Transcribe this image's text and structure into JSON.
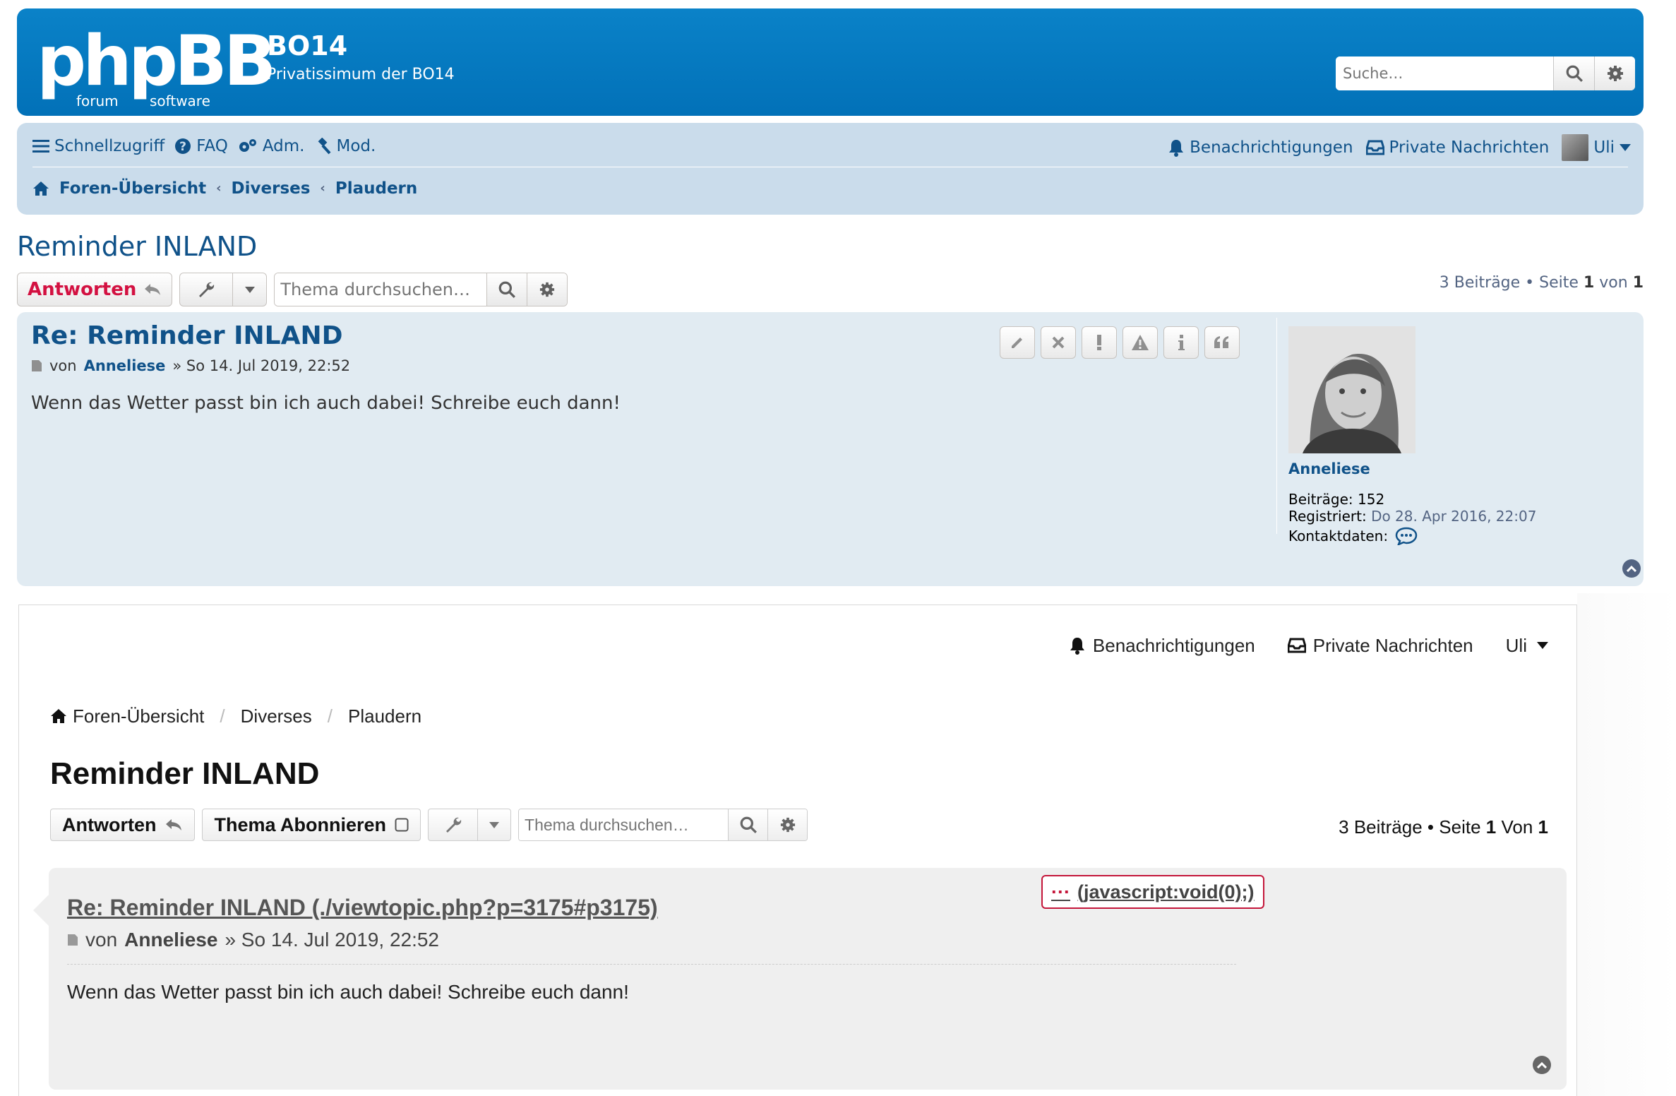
{
  "header": {
    "logo_main": "phpBB",
    "logo_sub_left": "forum",
    "logo_sub_right": "software",
    "site_title": "BO14",
    "site_desc": "Privatissimum der BO14",
    "search_placeholder": "Suche…"
  },
  "nav": {
    "quick": "Schnellzugriff",
    "faq": "FAQ",
    "acp": "Adm.",
    "mcp": "Mod.",
    "notifications": "Benachrichtigungen",
    "pm": "Private Nachrichten",
    "user": "Uli"
  },
  "breadcrumbs": [
    "Foren-Übersicht",
    "Diverses",
    "Plaudern"
  ],
  "topic": {
    "title": "Reminder INLAND",
    "reply": "Antworten",
    "search_placeholder": "Thema durchsuchen…",
    "pagination_count": "3 Beiträge",
    "pagination_page_word": "Seite",
    "pagination_page": "1",
    "pagination_of": "von",
    "pagination_total": "1"
  },
  "post": {
    "subject": "Re: Reminder INLAND",
    "by": "von",
    "author": "Anneliese",
    "date": "» So 14. Jul 2019, 22:52",
    "body": "Wenn das Wetter passt bin ich auch dabei! Schreibe euch dann!",
    "profile": {
      "name": "Anneliese",
      "posts_label": "Beiträge:",
      "posts_value": "152",
      "registered_label": "Registriert:",
      "registered_value": "Do 28. Apr 2016, 22:07",
      "contact_label": "Kontaktdaten:"
    }
  },
  "bottom": {
    "notifications": "Benachrichtigungen",
    "pm": "Private Nachrichten",
    "user": "Uli",
    "breadcrumbs": [
      "Foren-Übersicht",
      "Diverses",
      "Plaudern"
    ],
    "title": "Reminder INLAND",
    "reply": "Antworten",
    "subscribe": "Thema Abonnieren",
    "search_placeholder": "Thema durchsuchen…",
    "pagination_count": "3 Beiträge",
    "pagination_bullet": "•",
    "pagination_page_word": "Seite",
    "pagination_page": "1",
    "pagination_of": "Von",
    "pagination_total": "1",
    "post_subject": "Re: Reminder INLAND (./viewtopic.php?p=3175#p3175)",
    "post_by": "von",
    "post_author": "Anneliese",
    "post_date": "» So 14. Jul 2019, 22:52",
    "post_body": "Wenn das Wetter passt bin ich auch dabei! Schreibe euch dann!",
    "js_link_dots": "···",
    "js_link": " (javascript:void(0);)"
  },
  "colors": {
    "header_blue": "#0271b8",
    "nav_bg": "#cadceb",
    "post_bg": "#e1ebf2",
    "link": "#105289",
    "reply_red": "#d31141",
    "js_border": "#c4163a"
  }
}
